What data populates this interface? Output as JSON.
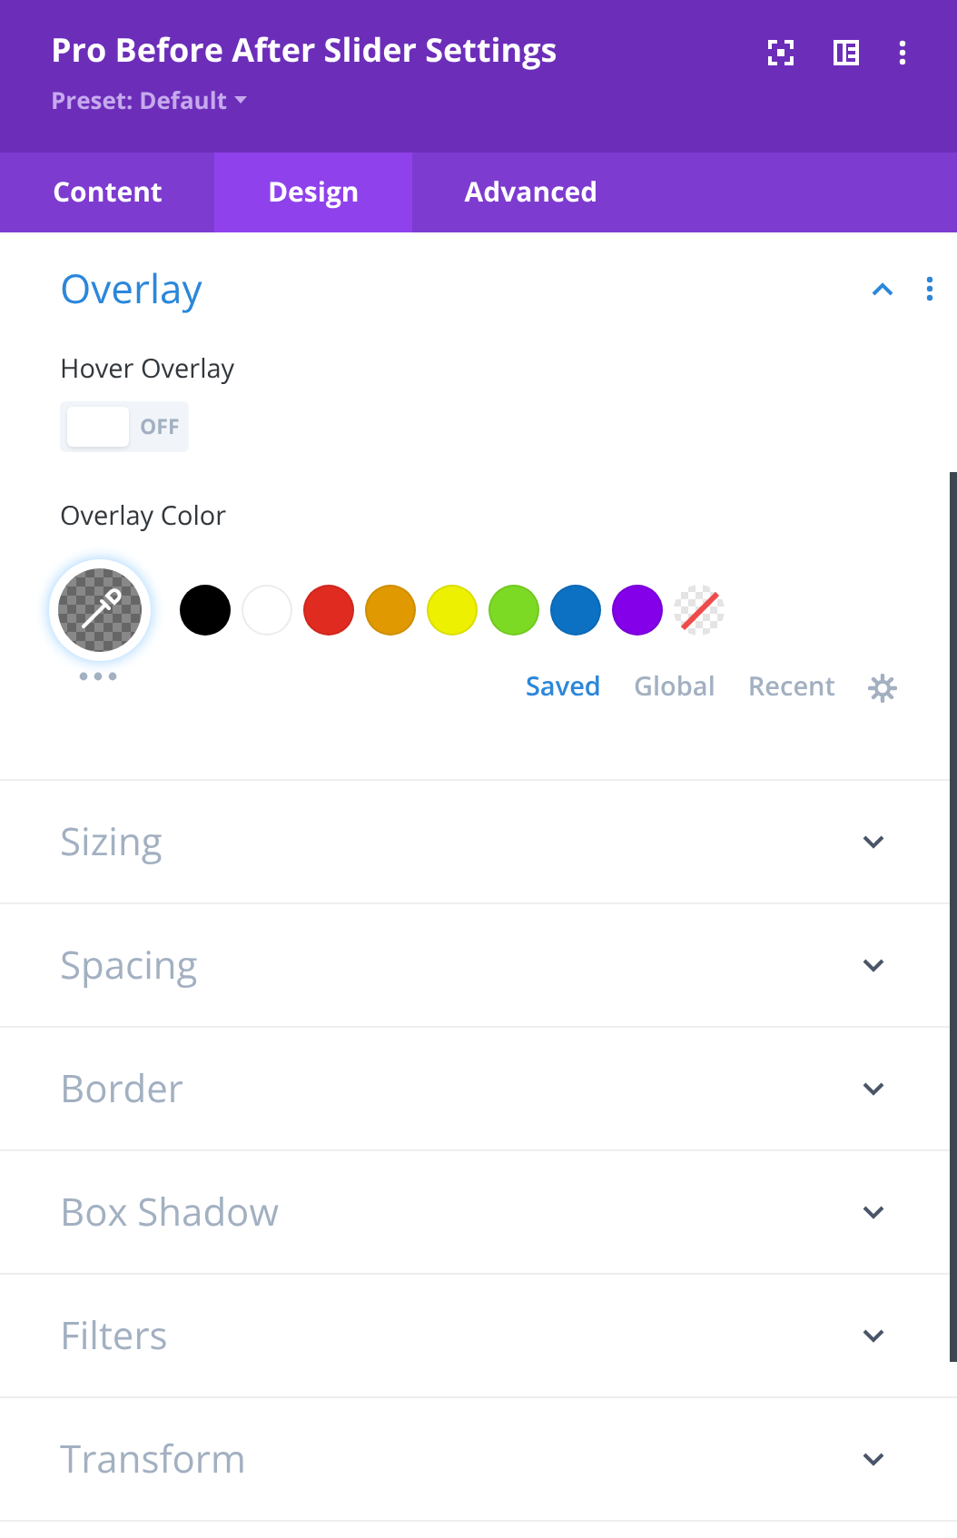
{
  "header": {
    "title": "Pro Before After Slider Settings",
    "preset": "Preset: Default"
  },
  "tabs": [
    {
      "label": "Content",
      "selected": false
    },
    {
      "label": "Design",
      "selected": true
    },
    {
      "label": "Advanced",
      "selected": false
    }
  ],
  "overlay": {
    "title": "Overlay",
    "expanded": true,
    "hover_label": "Hover Overlay",
    "hover_toggle": {
      "on": false,
      "label": "OFF"
    },
    "color_label": "Overlay Color",
    "swatches": [
      {
        "kind": "color",
        "color": "#000000"
      },
      {
        "kind": "color",
        "color": "#ffffff"
      },
      {
        "kind": "color",
        "color": "#e02b20"
      },
      {
        "kind": "color",
        "color": "#e09900"
      },
      {
        "kind": "color",
        "color": "#edf000"
      },
      {
        "kind": "color",
        "color": "#7cda24"
      },
      {
        "kind": "color",
        "color": "#0c71c3"
      },
      {
        "kind": "color",
        "color": "#8300e9"
      },
      {
        "kind": "none"
      }
    ],
    "palette_tabs": [
      {
        "label": "Saved",
        "selected": true
      },
      {
        "label": "Global",
        "selected": false
      },
      {
        "label": "Recent",
        "selected": false
      }
    ]
  },
  "sections": [
    {
      "title": "Sizing",
      "expanded": false
    },
    {
      "title": "Spacing",
      "expanded": false
    },
    {
      "title": "Border",
      "expanded": false
    },
    {
      "title": "Box Shadow",
      "expanded": false
    },
    {
      "title": "Filters",
      "expanded": false
    },
    {
      "title": "Transform",
      "expanded": false
    }
  ]
}
